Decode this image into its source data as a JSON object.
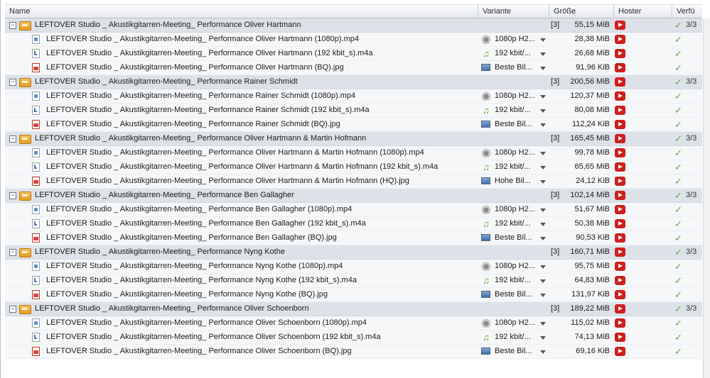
{
  "columns": {
    "name": "Name",
    "variant": "Variante",
    "size": "Größe",
    "hoster": "Hoster",
    "availability": "Verfü"
  },
  "packages": [
    {
      "name": "LEFTOVER Studio _ Akustikgitarren-Meeting_ Performance Oliver Hartmann",
      "count": "[3]",
      "size": "55,15 MiB",
      "availability": "3/3",
      "files": [
        {
          "name": "LEFTOVER Studio _ Akustikgitarren-Meeting_ Performance Oliver Hartmann (1080p).mp4",
          "type": "mp4",
          "variant": "1080p H2...",
          "size": "28,38 MiB"
        },
        {
          "name": "LEFTOVER Studio _ Akustikgitarren-Meeting_ Performance Oliver Hartmann (192 kbit_s).m4a",
          "type": "m4a",
          "variant": "192 kbit/...",
          "size": "26,68 MiB"
        },
        {
          "name": "LEFTOVER Studio _ Akustikgitarren-Meeting_ Performance Oliver Hartmann (BQ).jpg",
          "type": "jpg",
          "variant": "Beste Bil...",
          "size": "91,96 KiB"
        }
      ]
    },
    {
      "name": "LEFTOVER Studio _ Akustikgitarren-Meeting_ Performance Rainer Schmidt",
      "count": "[3]",
      "size": "200,56 MiB",
      "availability": "3/3",
      "files": [
        {
          "name": "LEFTOVER Studio _ Akustikgitarren-Meeting_ Performance Rainer Schmidt (1080p).mp4",
          "type": "mp4",
          "variant": "1080p H2...",
          "size": "120,37 MiB"
        },
        {
          "name": "LEFTOVER Studio _ Akustikgitarren-Meeting_ Performance Rainer Schmidt (192 kbit_s).m4a",
          "type": "m4a",
          "variant": "192 kbit/...",
          "size": "80,08 MiB"
        },
        {
          "name": "LEFTOVER Studio _ Akustikgitarren-Meeting_ Performance Rainer Schmidt (BQ).jpg",
          "type": "jpg",
          "variant": "Beste Bil...",
          "size": "112,24 KiB"
        }
      ]
    },
    {
      "name": "LEFTOVER Studio _ Akustikgitarren-Meeting_ Performance Oliver Hartmann & Martin Hofmann",
      "count": "[3]",
      "size": "165,45 MiB",
      "availability": "3/3",
      "files": [
        {
          "name": "LEFTOVER Studio _ Akustikgitarren-Meeting_ Performance Oliver Hartmann & Martin Hofmann (1080p).mp4",
          "type": "mp4",
          "variant": "1080p H2...",
          "size": "99,78 MiB"
        },
        {
          "name": "LEFTOVER Studio _ Akustikgitarren-Meeting_ Performance Oliver Hartmann & Martin Hofmann (192 kbit_s).m4a",
          "type": "m4a",
          "variant": "192 kbit/...",
          "size": "65,65 MiB"
        },
        {
          "name": "LEFTOVER Studio _ Akustikgitarren-Meeting_ Performance Oliver Hartmann & Martin Hofmann (HQ).jpg",
          "type": "jpg",
          "variant": "Hohe Bil...",
          "size": "24,12 KiB"
        }
      ]
    },
    {
      "name": "LEFTOVER Studio _ Akustikgitarren-Meeting_ Performance Ben Gallagher",
      "count": "[3]",
      "size": "102,14 MiB",
      "availability": "3/3",
      "files": [
        {
          "name": "LEFTOVER Studio _ Akustikgitarren-Meeting_ Performance Ben Gallagher (1080p).mp4",
          "type": "mp4",
          "variant": "1080p H2...",
          "size": "51,67 MiB"
        },
        {
          "name": "LEFTOVER Studio _ Akustikgitarren-Meeting_ Performance Ben Gallagher (192 kbit_s).m4a",
          "type": "m4a",
          "variant": "192 kbit/...",
          "size": "50,38 MiB"
        },
        {
          "name": "LEFTOVER Studio _ Akustikgitarren-Meeting_ Performance Ben Gallagher (BQ).jpg",
          "type": "jpg",
          "variant": "Beste Bil...",
          "size": "90,53 KiB"
        }
      ]
    },
    {
      "name": "LEFTOVER Studio _ Akustikgitarren-Meeting_ Performance Nyng Kothe",
      "count": "[3]",
      "size": "160,71 MiB",
      "availability": "3/3",
      "files": [
        {
          "name": "LEFTOVER Studio _ Akustikgitarren-Meeting_ Performance Nyng Kothe (1080p).mp4",
          "type": "mp4",
          "variant": "1080p H2...",
          "size": "95,75 MiB"
        },
        {
          "name": "LEFTOVER Studio _ Akustikgitarren-Meeting_ Performance Nyng Kothe (192 kbit_s).m4a",
          "type": "m4a",
          "variant": "192 kbit/...",
          "size": "64,83 MiB"
        },
        {
          "name": "LEFTOVER Studio _ Akustikgitarren-Meeting_ Performance Nyng Kothe (BQ).jpg",
          "type": "jpg",
          "variant": "Beste Bil...",
          "size": "131,97 KiB"
        }
      ]
    },
    {
      "name": "LEFTOVER Studio _ Akustikgitarren-Meeting_ Performance Oliver Schoenborn",
      "count": "[3]",
      "size": "189,22 MiB",
      "availability": "3/3",
      "files": [
        {
          "name": "LEFTOVER Studio _ Akustikgitarren-Meeting_ Performance Oliver Schoenborn (1080p).mp4",
          "type": "mp4",
          "variant": "1080p H2...",
          "size": "115,02 MiB"
        },
        {
          "name": "LEFTOVER Studio _ Akustikgitarren-Meeting_ Performance Oliver Schoenborn (192 kbit_s).m4a",
          "type": "m4a",
          "variant": "192 kbit/...",
          "size": "74,13 MiB"
        },
        {
          "name": "LEFTOVER Studio _ Akustikgitarren-Meeting_ Performance Oliver Schoenborn (BQ).jpg",
          "type": "jpg",
          "variant": "Beste Bil...",
          "size": "69,16 KiB"
        }
      ]
    }
  ]
}
